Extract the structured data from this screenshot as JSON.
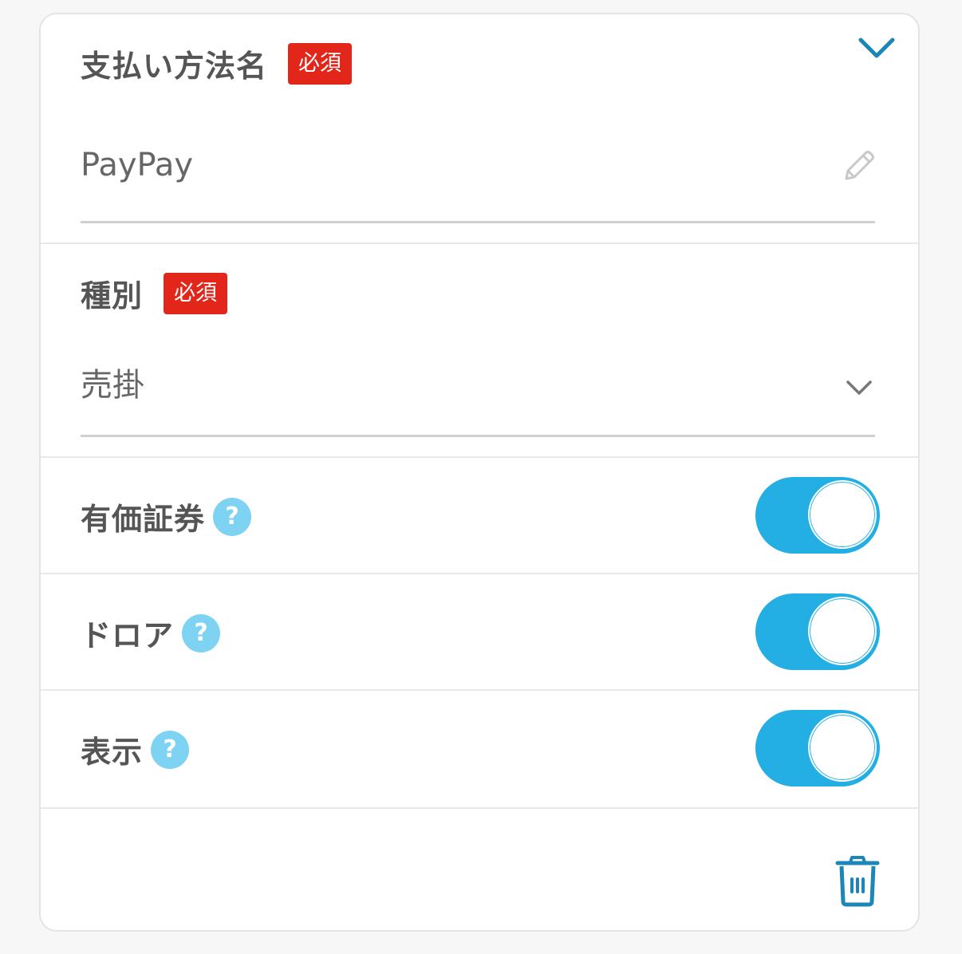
{
  "colors": {
    "accent": "#23afe3",
    "required_badge": "#e3261a",
    "help_icon": "#7fd3f2",
    "icon_blue": "#1c86b8"
  },
  "payment_name": {
    "label": "支払い方法名",
    "required_badge": "必須",
    "value": "PayPay",
    "edit_icon": "pencil-icon",
    "collapse_icon": "chevron-up-icon"
  },
  "category": {
    "label": "種別",
    "required_badge": "必須",
    "selected": "売掛",
    "dropdown_icon": "chevron-down-icon"
  },
  "toggles": [
    {
      "label": "有価証券",
      "help": "?",
      "on": true
    },
    {
      "label": "ドロア",
      "help": "?",
      "on": true
    },
    {
      "label": "表示",
      "help": "?",
      "on": true
    }
  ],
  "footer": {
    "delete_icon": "trash-icon"
  }
}
